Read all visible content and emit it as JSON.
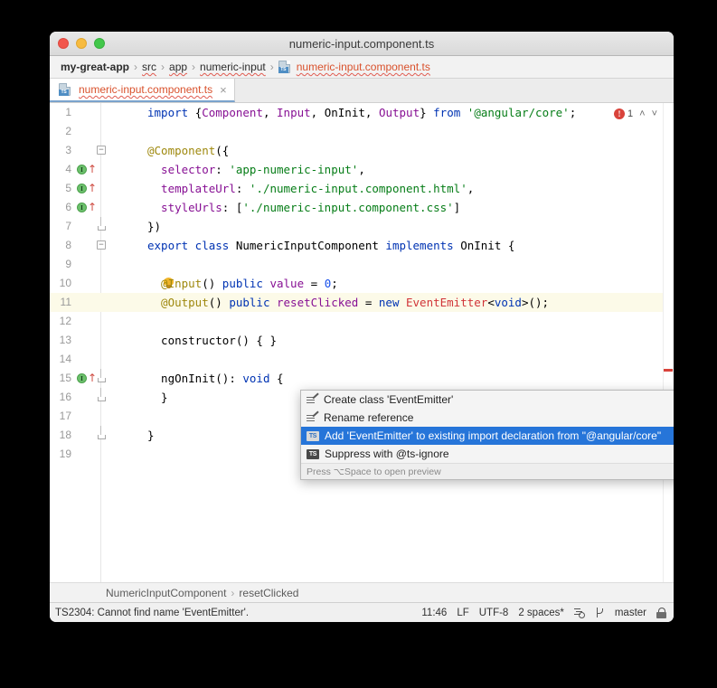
{
  "window": {
    "title": "numeric-input.component.ts",
    "controls": [
      "close",
      "minimize",
      "maximize"
    ]
  },
  "breadcrumb": {
    "items": [
      {
        "label": "my-great-app",
        "style": "bold"
      },
      {
        "label": "src",
        "style": "squiggly"
      },
      {
        "label": "app",
        "style": "squiggly"
      },
      {
        "label": "numeric-input",
        "style": "squiggly"
      },
      {
        "label": "numeric-input.component.ts",
        "style": "file",
        "icon": "ts-file-icon"
      }
    ],
    "separator": "›"
  },
  "tab": {
    "label": "numeric-input.component.ts",
    "icon": "ts-file-icon",
    "close": "×"
  },
  "editor": {
    "error_count": "1",
    "nav_up": "˄",
    "nav_down": "˅",
    "lines": [
      {
        "num": "1",
        "tokens": [
          {
            "t": "import ",
            "c": "kw"
          },
          {
            "t": "{",
            "c": "plain"
          },
          {
            "t": "Component",
            "c": "cls"
          },
          {
            "t": ", ",
            "c": "plain"
          },
          {
            "t": "Input",
            "c": "cls"
          },
          {
            "t": ", ",
            "c": "plain"
          },
          {
            "t": "OnInit",
            "c": "plain"
          },
          {
            "t": ", ",
            "c": "plain"
          },
          {
            "t": "Output",
            "c": "cls"
          },
          {
            "t": "} ",
            "c": "plain"
          },
          {
            "t": "from ",
            "c": "kw"
          },
          {
            "t": "'@angular/core'",
            "c": "str"
          },
          {
            "t": ";",
            "c": "plain"
          }
        ]
      },
      {
        "num": "2",
        "tokens": []
      },
      {
        "num": "3",
        "fold": "minus",
        "tokens": [
          {
            "t": "@Component",
            "c": "deco"
          },
          {
            "t": "({",
            "c": "plain"
          }
        ]
      },
      {
        "num": "4",
        "marker": "angular-gutter-icon",
        "tokens": [
          {
            "t": "  selector",
            "c": "field"
          },
          {
            "t": ": ",
            "c": "plain"
          },
          {
            "t": "'app-numeric-input'",
            "c": "str"
          },
          {
            "t": ",",
            "c": "plain"
          }
        ]
      },
      {
        "num": "5",
        "marker": "angular-gutter-icon",
        "tokens": [
          {
            "t": "  templateUrl",
            "c": "field"
          },
          {
            "t": ": ",
            "c": "plain"
          },
          {
            "t": "'./numeric-input.component.html'",
            "c": "str"
          },
          {
            "t": ",",
            "c": "plain"
          }
        ]
      },
      {
        "num": "6",
        "marker": "angular-gutter-icon",
        "tokens": [
          {
            "t": "  styleUrls",
            "c": "field"
          },
          {
            "t": ": [",
            "c": "plain"
          },
          {
            "t": "'./numeric-input.component.css'",
            "c": "str"
          },
          {
            "t": "]",
            "c": "plain"
          }
        ]
      },
      {
        "num": "7",
        "fold": "tick",
        "tokens": [
          {
            "t": "})",
            "c": "plain"
          }
        ]
      },
      {
        "num": "8",
        "fold": "minus",
        "tokens": [
          {
            "t": "export class ",
            "c": "kw"
          },
          {
            "t": "NumericInputComponent",
            "c": "plain"
          },
          {
            "t": " implements ",
            "c": "kw"
          },
          {
            "t": "OnInit",
            "c": "plain"
          },
          {
            "t": " {",
            "c": "plain"
          }
        ]
      },
      {
        "num": "9",
        "tokens": []
      },
      {
        "num": "10",
        "bulb": "intention-bulb-icon",
        "tokens": [
          {
            "t": "  @Input",
            "c": "deco"
          },
          {
            "t": "() ",
            "c": "plain"
          },
          {
            "t": "public ",
            "c": "kw"
          },
          {
            "t": "value",
            "c": "field"
          },
          {
            "t": " = ",
            "c": "plain"
          },
          {
            "t": "0",
            "c": "num"
          },
          {
            "t": ";",
            "c": "plain"
          }
        ]
      },
      {
        "num": "11",
        "highlight": true,
        "tokens": [
          {
            "t": "  @Output",
            "c": "deco"
          },
          {
            "t": "() ",
            "c": "plain"
          },
          {
            "t": "public ",
            "c": "kw"
          },
          {
            "t": "resetClicked",
            "c": "field"
          },
          {
            "t": " = ",
            "c": "plain"
          },
          {
            "t": "new ",
            "c": "kw"
          },
          {
            "t": "EventEmitter",
            "c": "err"
          },
          {
            "t": "<",
            "c": "plain"
          },
          {
            "t": "void",
            "c": "kw"
          },
          {
            "t": ">();",
            "c": "plain"
          }
        ]
      },
      {
        "num": "12",
        "tokens": []
      },
      {
        "num": "13",
        "tokens": [
          {
            "t": "  constructor",
            "c": "plain"
          },
          {
            "t": "() { }",
            "c": "plain"
          }
        ]
      },
      {
        "num": "14",
        "tokens": []
      },
      {
        "num": "15",
        "marker": "angular-gutter-icon",
        "fold": "tick-open",
        "tokens": [
          {
            "t": "  ngOnInit",
            "c": "plain"
          },
          {
            "t": "(): ",
            "c": "plain"
          },
          {
            "t": "void",
            "c": "kw"
          },
          {
            "t": " {",
            "c": "plain"
          }
        ]
      },
      {
        "num": "16",
        "fold": "tick",
        "tokens": [
          {
            "t": "  }",
            "c": "plain"
          }
        ]
      },
      {
        "num": "17",
        "tokens": []
      },
      {
        "num": "18",
        "fold": "tick",
        "tokens": [
          {
            "t": "}",
            "c": "plain"
          }
        ]
      },
      {
        "num": "19",
        "tokens": []
      }
    ]
  },
  "popup": {
    "items": [
      {
        "label": "Create class 'EventEmitter'",
        "icon": "edit-icon",
        "submenu": "▶",
        "selected": false
      },
      {
        "label": "Rename reference",
        "icon": "edit-icon",
        "submenu": "▶",
        "selected": false
      },
      {
        "label": "Add 'EventEmitter' to existing import declaration from \"@angular/core\"",
        "icon": "ts-badge-icon",
        "icon_text": "TS",
        "submenu": "",
        "selected": true
      },
      {
        "label": "Suppress with @ts-ignore",
        "icon": "ts-badge-icon",
        "icon_text": "TS",
        "submenu": "",
        "selected": false
      }
    ],
    "hint": "Press ⌥Space to open preview"
  },
  "bottom_breadcrumb": {
    "items": [
      "NumericInputComponent",
      "resetClicked"
    ],
    "separator": "›"
  },
  "statusbar": {
    "message": "TS2304: Cannot find name 'EventEmitter'.",
    "caret_position": "11:46",
    "line_separator": "LF",
    "encoding": "UTF-8",
    "indent": "2 spaces*",
    "branch": "master"
  }
}
